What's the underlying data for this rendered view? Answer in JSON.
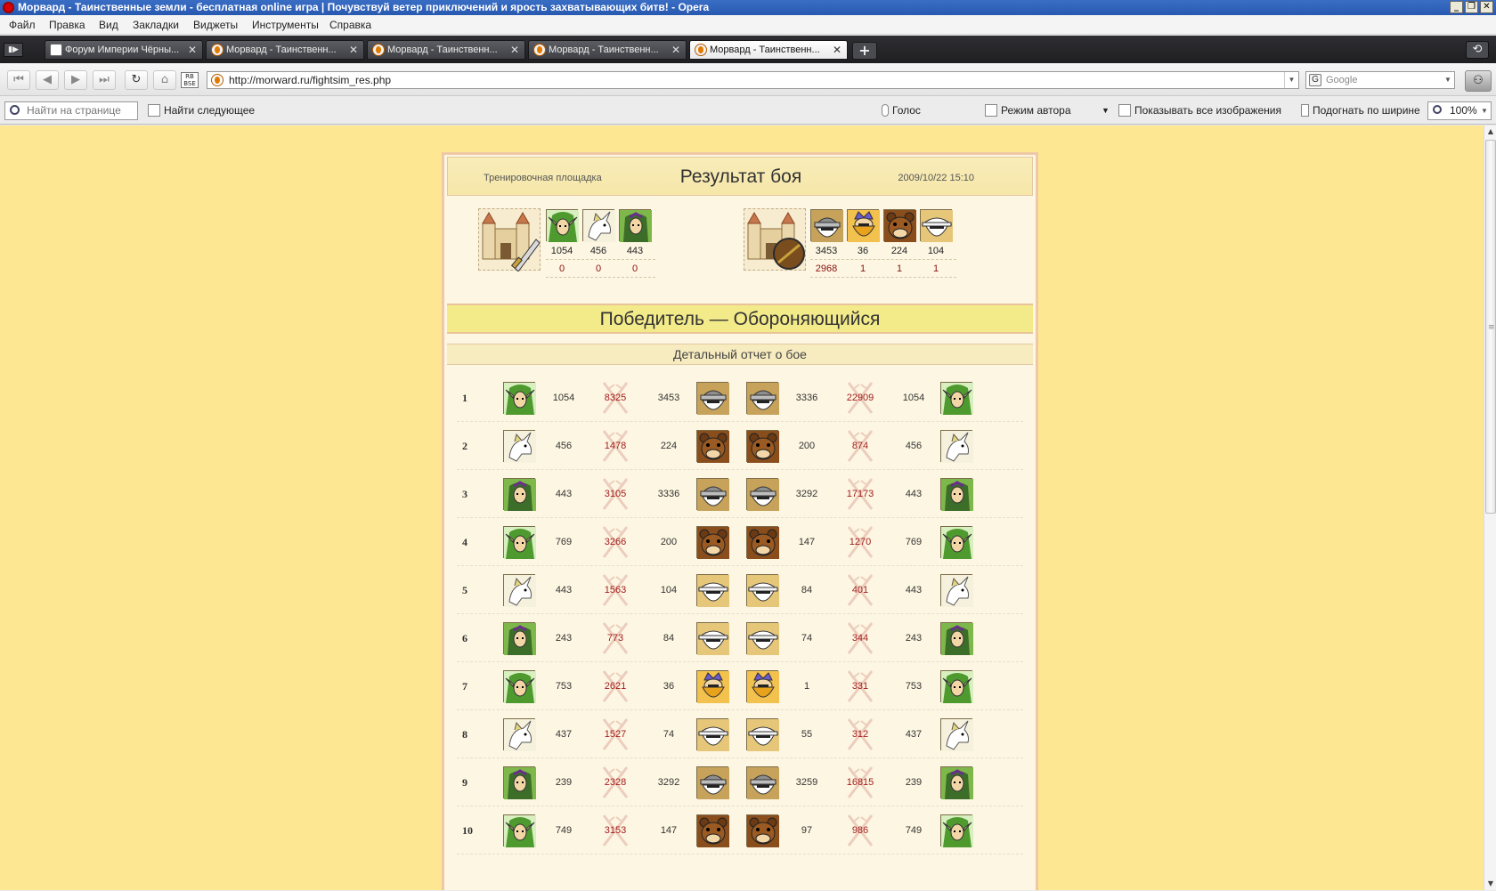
{
  "window": {
    "title": "Морвард - Таинственные земли - бесплатная online игра | Почувствуй ветер приключений и ярость захватывающих битв! - Opera",
    "controls": [
      "_",
      "❐",
      "✕"
    ]
  },
  "menu": [
    "Файл",
    "Правка",
    "Вид",
    "Закладки",
    "Виджеты",
    "Инструменты",
    "Справка"
  ],
  "tabs": [
    {
      "label": "Форум Империи Чёрны...",
      "active": false
    },
    {
      "label": "Морвард - Таинственн...",
      "active": false
    },
    {
      "label": "Морвард - Таинственн...",
      "active": false
    },
    {
      "label": "Морвард - Таинственн...",
      "active": false
    },
    {
      "label": "Морвард - Таинственн...",
      "active": true
    }
  ],
  "newtab_label": "+",
  "close_glyph": "✕",
  "address": {
    "url": "http://morward.ru/fightsim_res.php",
    "search_placeholder": "Google"
  },
  "findbar": {
    "placeholder": "Найти на странице",
    "find_next": "Найти следующее",
    "voice": "Голос",
    "author_mode": "Режим автора",
    "show_images": "Показывать все изображения",
    "fit_width": "Подогнать по ширине",
    "zoom": "100%"
  },
  "battle": {
    "location": "Тренировочная площадка",
    "title": "Результат боя",
    "datetime": "2009/10/22 15:10",
    "attacker": {
      "units": [
        "elf-warrior",
        "unicorn",
        "elf-druid"
      ],
      "counts": [
        "1054",
        "456",
        "443"
      ],
      "losses": [
        "0",
        "0",
        "0"
      ]
    },
    "defender": {
      "units": [
        "dwarf-helmet",
        "dwarf-king",
        "bear",
        "dwarf-miner"
      ],
      "counts": [
        "3453",
        "36",
        "224",
        "104"
      ],
      "losses": [
        "2968",
        "1",
        "1",
        "1"
      ]
    },
    "winner": "Победитель — Обороняющийся",
    "report_title": "Детальный отчет о бое",
    "rounds": [
      {
        "n": "1",
        "a_unit": "elf-warrior",
        "a_count": "1054",
        "a_dmg": "8325",
        "d_count": "3453",
        "d_unit": "dwarf-helmet",
        "d_unit2": "dwarf-helmet",
        "d_count2": "3336",
        "d_dmg": "22909",
        "a_count2": "1054",
        "a_unit2": "elf-warrior"
      },
      {
        "n": "2",
        "a_unit": "unicorn",
        "a_count": "456",
        "a_dmg": "1478",
        "d_count": "224",
        "d_unit": "bear",
        "d_unit2": "bear",
        "d_count2": "200",
        "d_dmg": "874",
        "a_count2": "456",
        "a_unit2": "unicorn"
      },
      {
        "n": "3",
        "a_unit": "elf-druid",
        "a_count": "443",
        "a_dmg": "3105",
        "d_count": "3336",
        "d_unit": "dwarf-helmet",
        "d_unit2": "dwarf-helmet",
        "d_count2": "3292",
        "d_dmg": "17173",
        "a_count2": "443",
        "a_unit2": "elf-druid"
      },
      {
        "n": "4",
        "a_unit": "elf-warrior",
        "a_count": "769",
        "a_dmg": "3266",
        "d_count": "200",
        "d_unit": "bear",
        "d_unit2": "bear",
        "d_count2": "147",
        "d_dmg": "1270",
        "a_count2": "769",
        "a_unit2": "elf-warrior"
      },
      {
        "n": "5",
        "a_unit": "unicorn",
        "a_count": "443",
        "a_dmg": "1563",
        "d_count": "104",
        "d_unit": "dwarf-miner",
        "d_unit2": "dwarf-miner",
        "d_count2": "84",
        "d_dmg": "401",
        "a_count2": "443",
        "a_unit2": "unicorn"
      },
      {
        "n": "6",
        "a_unit": "elf-druid",
        "a_count": "243",
        "a_dmg": "773",
        "d_count": "84",
        "d_unit": "dwarf-miner",
        "d_unit2": "dwarf-miner",
        "d_count2": "74",
        "d_dmg": "344",
        "a_count2": "243",
        "a_unit2": "elf-druid"
      },
      {
        "n": "7",
        "a_unit": "elf-warrior",
        "a_count": "753",
        "a_dmg": "2621",
        "d_count": "36",
        "d_unit": "dwarf-king",
        "d_unit2": "dwarf-king",
        "d_count2": "1",
        "d_dmg": "331",
        "a_count2": "753",
        "a_unit2": "elf-warrior"
      },
      {
        "n": "8",
        "a_unit": "unicorn",
        "a_count": "437",
        "a_dmg": "1527",
        "d_count": "74",
        "d_unit": "dwarf-miner",
        "d_unit2": "dwarf-miner",
        "d_count2": "55",
        "d_dmg": "312",
        "a_count2": "437",
        "a_unit2": "unicorn"
      },
      {
        "n": "9",
        "a_unit": "elf-druid",
        "a_count": "239",
        "a_dmg": "2328",
        "d_count": "3292",
        "d_unit": "dwarf-helmet",
        "d_unit2": "dwarf-helmet",
        "d_count2": "3259",
        "d_dmg": "16815",
        "a_count2": "239",
        "a_unit2": "elf-druid"
      },
      {
        "n": "10",
        "a_unit": "elf-warrior",
        "a_count": "749",
        "a_dmg": "3153",
        "d_count": "147",
        "d_unit": "bear",
        "d_unit2": "bear",
        "d_count2": "97",
        "d_dmg": "986",
        "a_count2": "749",
        "a_unit2": "elf-warrior"
      }
    ]
  },
  "colors": {
    "page_bg": "#fee792",
    "frame_bg": "#fdf6e2",
    "winner_bg": "#f3ea8a",
    "loss_red": "#a31c1c"
  }
}
